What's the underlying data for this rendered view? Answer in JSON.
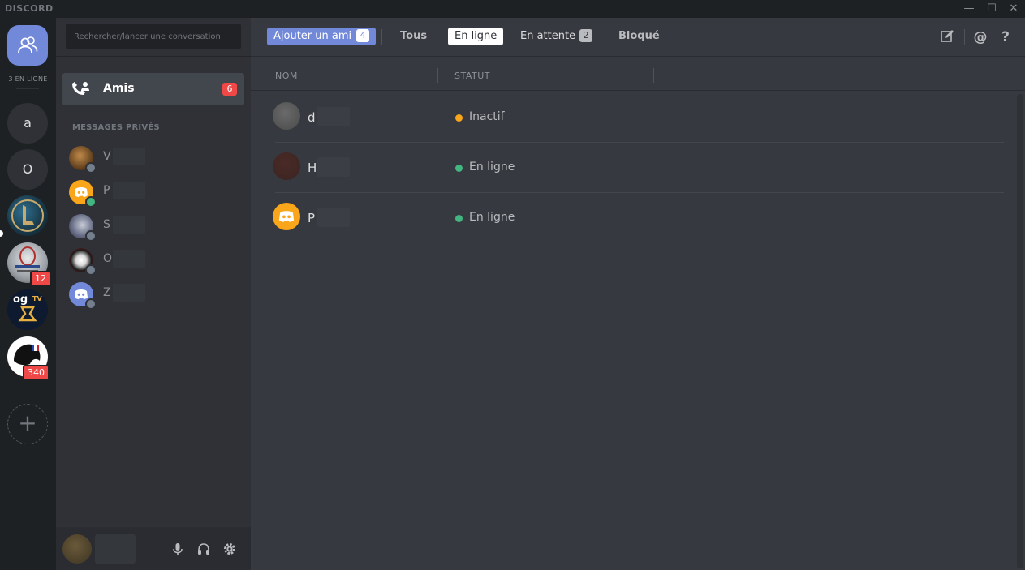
{
  "window": {
    "brand": "DISCORD",
    "controls": {
      "minimize": "—",
      "maximize": "☐",
      "close": "✕"
    }
  },
  "guilds": {
    "online_count": "3 EN LIGNE",
    "letters": [
      "a",
      "O"
    ],
    "badges": {
      "esports": "12",
      "white": "340"
    },
    "add": "+"
  },
  "dms": {
    "search_placeholder": "Rechercher/lancer une conversation",
    "friends": {
      "label": "Amis",
      "badge": "6"
    },
    "header": "MESSAGES PRIVÉS",
    "items": [
      {
        "initial": "V",
        "status": "offline"
      },
      {
        "initial": "P",
        "status": "online"
      },
      {
        "initial": "S",
        "status": "offline"
      },
      {
        "initial": "O",
        "status": "offline"
      },
      {
        "initial": "Z",
        "status": "offline"
      }
    ]
  },
  "tabs": {
    "add_friend": "Ajouter un ami",
    "add_friend_count": "4",
    "all": "Tous",
    "online": "En ligne",
    "pending": "En attente",
    "pending_count": "2",
    "blocked": "Bloqué"
  },
  "topicons": {
    "at": "@",
    "help": "?"
  },
  "columns": {
    "name": "NOM",
    "status": "STATUT"
  },
  "friends_list": [
    {
      "initial": "d",
      "status": "Inactif",
      "status_color": "#faa61a"
    },
    {
      "initial": "H",
      "status": "En ligne",
      "status_color": "#43b581"
    },
    {
      "initial": "P",
      "status": "En ligne",
      "status_color": "#43b581"
    }
  ],
  "colors": {
    "blurple": "#7289da",
    "online": "#43b581",
    "idle": "#faa61a",
    "offline": "#747f8d",
    "badge": "#f04747"
  }
}
